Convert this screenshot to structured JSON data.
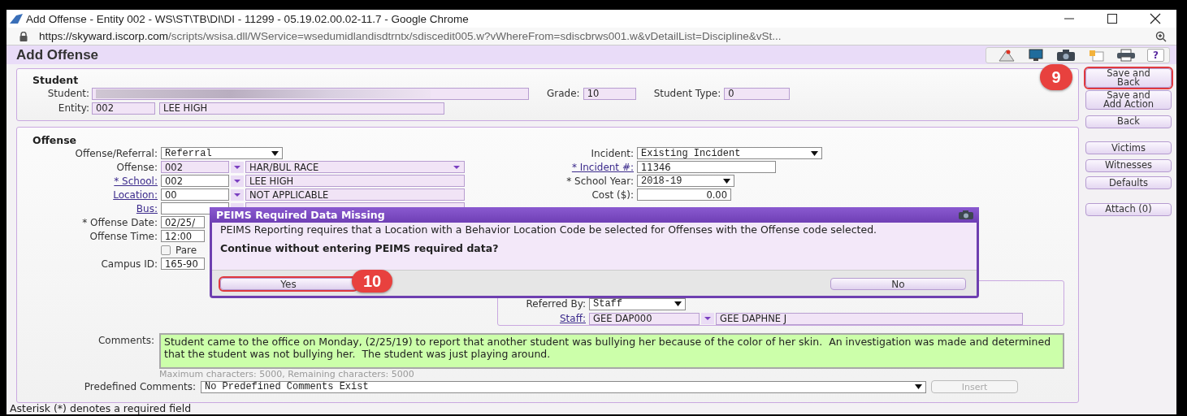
{
  "browser": {
    "title": "Add Offense - Entity 002 - WS\\ST\\TB\\DI\\DI - 11299 - 05.19.02.00.02-11.7 - Google Chrome",
    "url_host": "https://skyward.iscorp.com",
    "url_path": "/scripts/wsisa.dll/WService=wsedumidlandisdtrntx/sdiscedit005.w?vWhereFrom=sdiscbrws001.w&vDetailList=Discipline&vSt..."
  },
  "page": {
    "title": "Add Offense",
    "help": "?"
  },
  "student": {
    "heading": "Student",
    "student_label": "Student:",
    "grade_label": "Grade:",
    "grade": "10",
    "type_label": "Student Type:",
    "type": "0",
    "entity_label": "Entity:",
    "entity_code": "002",
    "entity_name": "LEE HIGH"
  },
  "offense": {
    "heading": "Offense",
    "left": [
      {
        "kind": "select",
        "label": "Offense/Referral:",
        "link": false,
        "value": "Referral"
      },
      {
        "kind": "lookup",
        "label": "Offense:",
        "link": false,
        "code": "002",
        "name": "HAR/BUL RACE",
        "name_dropdown": true
      },
      {
        "kind": "lookup",
        "label": "* School:",
        "link": true,
        "code": "002",
        "name": "LEE HIGH",
        "name_dropdown": false
      },
      {
        "kind": "lookup",
        "label": "Location:",
        "link": true,
        "code": "00",
        "name": "NOT APPLICABLE",
        "name_dropdown": false
      },
      {
        "kind": "lookup",
        "label": "Bus:",
        "link": true,
        "name_dropdown": false
      },
      {
        "kind": "text",
        "label": "* Offense Date:",
        "link": false,
        "value": "02/25/"
      },
      {
        "kind": "text",
        "label": "Offense Time:",
        "link": false,
        "value": "12:00"
      },
      {
        "kind": "checkbox",
        "label": "Pare",
        "checked": false
      },
      {
        "kind": "text",
        "label": "Campus ID:",
        "link": false,
        "value": "165-90"
      }
    ],
    "right": [
      {
        "kind": "select",
        "label": "Incident:",
        "link": false,
        "value": "Existing Incident"
      },
      {
        "kind": "text",
        "label": "* Incident #:",
        "link": true,
        "value": "11346"
      },
      {
        "kind": "select",
        "label": "* School Year:",
        "link": false,
        "value": "2018-19"
      },
      {
        "kind": "amount",
        "label": "Cost ($):",
        "link": false,
        "value": "0.00"
      }
    ],
    "referral": {
      "referred_label": "Referred By:",
      "referred_value": "Staff",
      "staff_label": "Staff:",
      "staff_code": "GEE  DAP000",
      "staff_name": "GEE DAPHNE J"
    },
    "comments_label": "Comments:",
    "comments": "Student came to the office on Monday, (2/25/19) to report that another student was bullying her because of the color of her skin.  An investigation was made and determined that the student was not bullying her.  The student was just playing around.",
    "comments_hint": "Maximum characters: 5000, Remaining characters: 5000",
    "predefined_label": "Predefined Comments:",
    "predefined_value": "No Predefined Comments Exist",
    "insert": {
      "label": "Insert",
      "disabled": true
    }
  },
  "action_groups": [
    [
      {
        "label": "Save and Back",
        "highlighted": true,
        "callout": "9"
      },
      {
        "label": "Save and Add Action",
        "highlighted": false
      },
      {
        "label": "Back",
        "highlighted": false
      }
    ],
    [
      {
        "label": "Victims",
        "highlighted": false
      },
      {
        "label": "Witnesses",
        "highlighted": false
      },
      {
        "label": "Defaults",
        "highlighted": false
      }
    ],
    [
      {
        "label": "Attach (0)",
        "highlighted": false
      }
    ]
  ],
  "footer": "Asterisk (*) denotes a required field",
  "dialog": {
    "title": "PEIMS Required Data Missing",
    "message": "PEIMS Reporting requires that a Location with a Behavior Location Code be selected for Offenses with the Offense code selected.",
    "question": "Continue without entering PEIMS required data?",
    "buttons": [
      {
        "label": "Yes",
        "highlighted": true,
        "callout": "10"
      },
      {
        "label": "No",
        "highlighted": false
      }
    ]
  }
}
